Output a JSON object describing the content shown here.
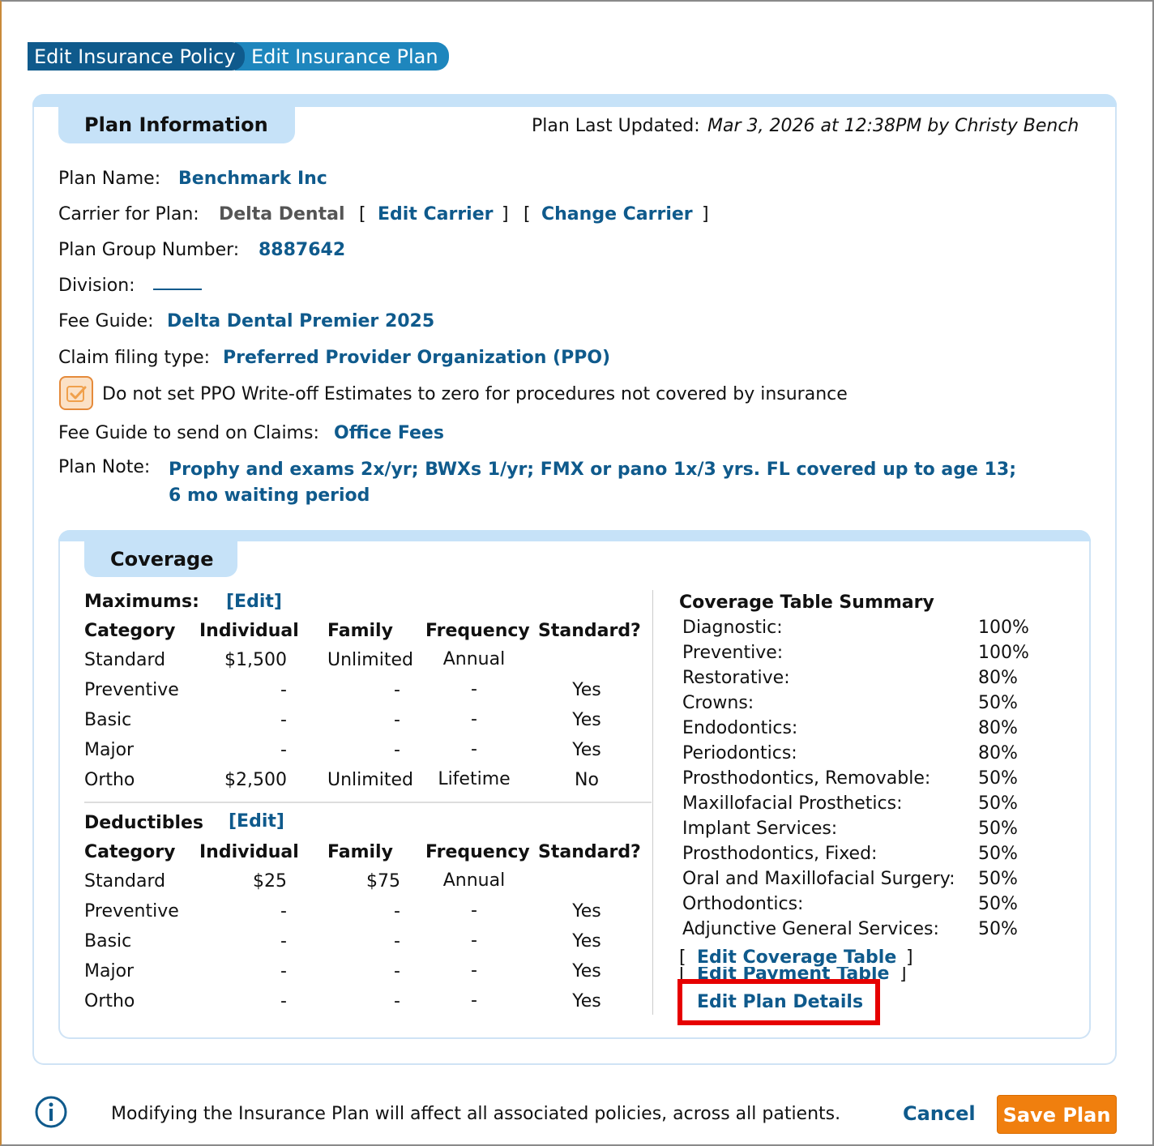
{
  "tabs": [
    {
      "label": "Edit Insurance Policy"
    },
    {
      "label": "Edit Insurance Plan"
    }
  ],
  "plan_info": {
    "title": "Plan Information",
    "last_updated_label": "Plan Last Updated:",
    "last_updated_value": "Mar 3, 2026 at 12:38PM by Christy Bench",
    "plan_name_label": "Plan Name:",
    "plan_name": "Benchmark Inc",
    "carrier_label": "Carrier for Plan:",
    "carrier": "Delta Dental",
    "edit_carrier": "Edit Carrier",
    "change_carrier": "Change Carrier",
    "group_number_label": "Plan Group Number:",
    "group_number": "8887642",
    "division_label": "Division:",
    "fee_guide_label": "Fee Guide:",
    "fee_guide": "Delta Dental Premier 2025",
    "claim_type_label": "Claim filing type:",
    "claim_type": "Preferred Provider Organization (PPO)",
    "checkbox_label": "Do not set PPO Write-off Estimates to zero for procedures not covered by insurance",
    "checkbox_checked": true,
    "claims_fee_guide_label": "Fee Guide to send on Claims:",
    "claims_fee_guide": "Office Fees",
    "plan_note_label": "Plan Note:",
    "plan_note_line1": "Prophy and exams 2x/yr; BWXs 1/yr; FMX or pano 1x/3 yrs. FL covered up to age 13;",
    "plan_note_line2": "6 mo waiting period"
  },
  "coverage": {
    "title": "Coverage",
    "maximums_label": "Maximums:",
    "deductibles_label": "Deductibles",
    "edit_label": "[Edit]",
    "headers": [
      "Category",
      "Individual",
      "Family",
      "Frequency",
      "Standard?"
    ],
    "maximums": [
      [
        "Standard",
        "$1,500",
        "Unlimited",
        "Annual",
        ""
      ],
      [
        "Preventive",
        "-",
        "-",
        "-",
        "Yes"
      ],
      [
        "Basic",
        "-",
        "-",
        "-",
        "Yes"
      ],
      [
        "Major",
        "-",
        "-",
        "-",
        "Yes"
      ],
      [
        "Ortho",
        "$2,500",
        "Unlimited",
        "Lifetime",
        "No"
      ]
    ],
    "deductibles": [
      [
        "Standard",
        "$25",
        "$75",
        "Annual",
        ""
      ],
      [
        "Preventive",
        "-",
        "-",
        "-",
        "Yes"
      ],
      [
        "Basic",
        "-",
        "-",
        "-",
        "Yes"
      ],
      [
        "Major",
        "-",
        "-",
        "-",
        "Yes"
      ],
      [
        "Ortho",
        "-",
        "-",
        "-",
        "Yes"
      ]
    ],
    "summary_title": "Coverage Table Summary",
    "summary": [
      [
        "Diagnostic:",
        "100%"
      ],
      [
        "Preventive:",
        "100%"
      ],
      [
        "Restorative:",
        "80%"
      ],
      [
        "Crowns:",
        "50%"
      ],
      [
        "Endodontics:",
        "80%"
      ],
      [
        "Periodontics:",
        "80%"
      ],
      [
        "Prosthodontics, Removable:",
        "50%"
      ],
      [
        "Maxillofacial Prosthetics:",
        "50%"
      ],
      [
        "Implant Services:",
        "50%"
      ],
      [
        "Prosthodontics, Fixed:",
        "50%"
      ],
      [
        "Oral and Maxillofacial Surgery:",
        "50%"
      ],
      [
        "Orthodontics:",
        "50%"
      ],
      [
        "Adjunctive General Services:",
        "50%"
      ]
    ],
    "edit_coverage_table": "Edit Coverage Table",
    "edit_payment_table": "Edit Payment Table",
    "edit_plan_details": "Edit Plan Details"
  },
  "footer": {
    "message": "Modifying the Insurance Plan will affect all associated policies, across all patients.",
    "cancel": "Cancel",
    "save": "Save Plan"
  },
  "colors": {
    "link": "#0f5a8c",
    "tab_active": "#0f5a8c",
    "tab_inactive": "#1e86bd",
    "band": "#c6e2f8",
    "save": "#f07f0e",
    "highlight": "#e60000"
  }
}
